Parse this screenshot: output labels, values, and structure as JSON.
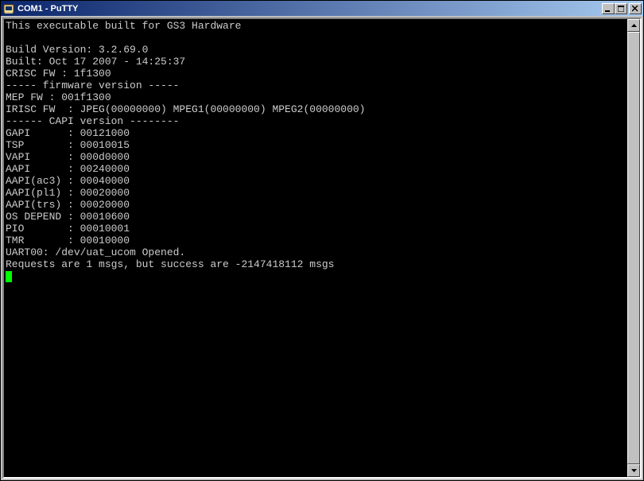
{
  "window": {
    "title": "COM1 - PuTTY",
    "icon_name": "putty-icon"
  },
  "terminal": {
    "lines": [
      "This executable built for GS3 Hardware",
      "",
      "Build Version: 3.2.69.0",
      "Built: Oct 17 2007 - 14:25:37",
      "CRISC FW : 1f1300",
      "----- firmware version -----",
      "MEP FW : 001f1300",
      "IRISC FW  : JPEG(00000000) MPEG1(00000000) MPEG2(00000000)",
      "------ CAPI version --------",
      "GAPI      : 00121000",
      "TSP       : 00010015",
      "VAPI      : 000d0000",
      "AAPI      : 00240000",
      "AAPI(ac3) : 00040000",
      "AAPI(pl1) : 00020000",
      "AAPI(trs) : 00020000",
      "OS DEPEND : 00010600",
      "PIO       : 00010001",
      "TMR       : 00010000",
      "UART00: /dev/uat_ucom Opened.",
      "Requests are 1 msgs, but success are -2147418112 msgs"
    ]
  },
  "controls": {
    "minimize": "_",
    "maximize": "□",
    "close": "✕"
  },
  "scroll": {
    "up": "▲",
    "down": "▼"
  }
}
